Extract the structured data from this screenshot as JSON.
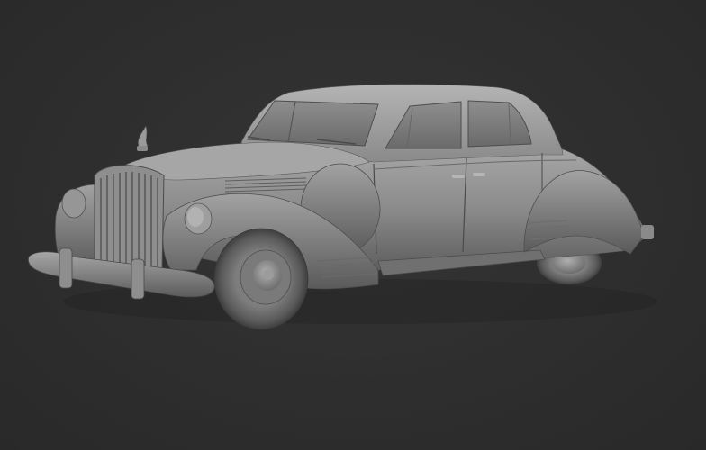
{
  "scene": {
    "subject": "car-model",
    "background_color": "#2d2d2d",
    "model_color": "#8a8a8a"
  }
}
